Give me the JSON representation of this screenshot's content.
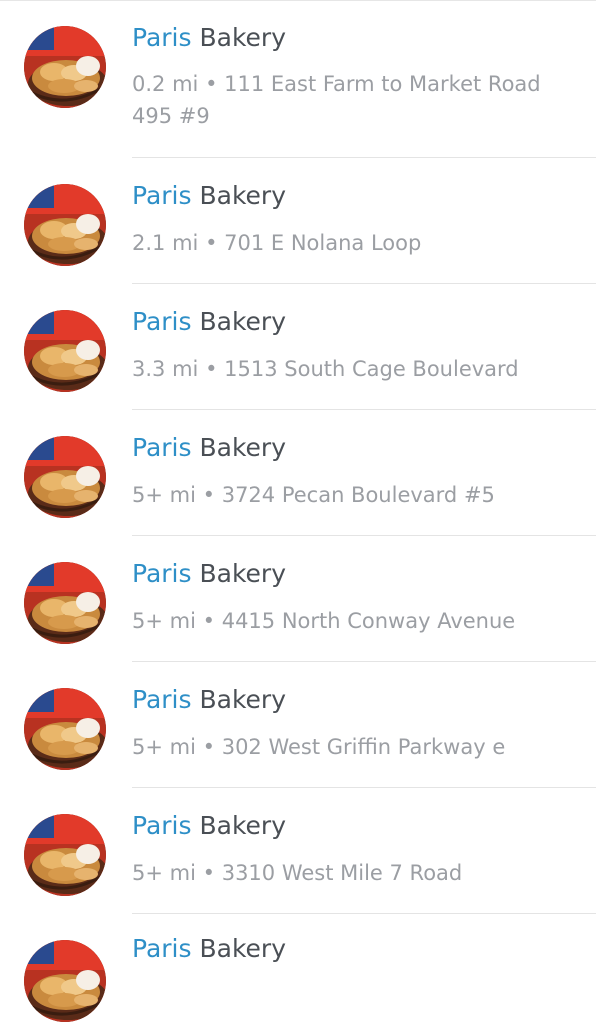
{
  "results": [
    {
      "name_highlight": "Paris",
      "name_rest": " Bakery",
      "distance": "0.2 mi",
      "separator": "•",
      "address": "111 East Farm to Market Road 495 #9"
    },
    {
      "name_highlight": "Paris",
      "name_rest": " Bakery",
      "distance": "2.1 mi",
      "separator": "•",
      "address": "701 E Nolana Loop"
    },
    {
      "name_highlight": "Paris",
      "name_rest": " Bakery",
      "distance": "3.3 mi",
      "separator": "•",
      "address": "1513 South Cage Boulevard"
    },
    {
      "name_highlight": "Paris",
      "name_rest": " Bakery",
      "distance": "5+ mi",
      "separator": "•",
      "address": "3724 Pecan Boulevard #5"
    },
    {
      "name_highlight": "Paris",
      "name_rest": " Bakery",
      "distance": "5+ mi",
      "separator": "•",
      "address": "4415 North Conway Avenue"
    },
    {
      "name_highlight": "Paris",
      "name_rest": " Bakery",
      "distance": "5+ mi",
      "separator": "•",
      "address": "302 West Griffin Parkway e"
    },
    {
      "name_highlight": "Paris",
      "name_rest": " Bakery",
      "distance": "5+ mi",
      "separator": "•",
      "address": "3310 West Mile 7 Road"
    },
    {
      "name_highlight": "Paris",
      "name_rest": " Bakery",
      "distance": "",
      "separator": "",
      "address": ""
    }
  ],
  "colors": {
    "highlight": "#2e8fc7",
    "name": "#4a4f55",
    "meta": "#9b9ea3",
    "divider": "#e4e4e4"
  },
  "icons": {
    "thumbnail": "bakery-photo-thumbnail"
  }
}
